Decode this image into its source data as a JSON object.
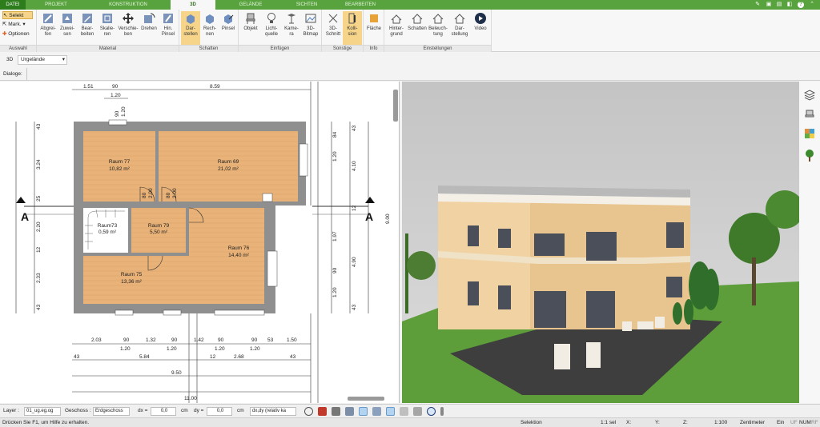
{
  "tabs": [
    "DATEI",
    "PROJEKT",
    "KONSTRUKTION",
    "3D",
    "GELÄNDE",
    "SICHTEN",
    "BEARBEITEN"
  ],
  "window_controls": [
    "?"
  ],
  "ribbon": {
    "auswahl": {
      "label": "Auswahl",
      "selekt": "Selekt",
      "mark": "Mark.",
      "optionen": "Optionen"
    },
    "material": {
      "label": "Material",
      "buttons": [
        "Abgrei-\nfen",
        "Zuwei-\nsen",
        "Bear-\nbeiten",
        "Skalie-\nren",
        "Verschie-\nben",
        "Drehen",
        "Hin.\nPinsel"
      ]
    },
    "schatten": {
      "label": "Schatten",
      "buttons": [
        "Dar-\nstellen",
        "Rech-\nnen",
        "Pinsel"
      ]
    },
    "einfuegen": {
      "label": "Einfügen",
      "buttons": [
        "Objekt",
        "Licht-\nquelle",
        "Kame-\nra",
        "3D-\nBitmap"
      ]
    },
    "sonstige": {
      "label": "Sonstige",
      "buttons": [
        "3D-\nSchnitt",
        "Kolli-\nsion"
      ]
    },
    "info": {
      "label": "Info",
      "buttons": [
        "Fläche"
      ]
    },
    "einstellungen": {
      "label": "Einstellungen",
      "buttons": [
        "Hinter-\ngrund",
        "Schatten",
        "Beleuch-\ntung",
        "Dar-\nstellung",
        "Video"
      ]
    }
  },
  "viewbar": {
    "mode": "3D",
    "terrain": "Urgelände"
  },
  "dialog_label": "Dialoge:",
  "plan": {
    "rooms": [
      {
        "name": "Raum 77",
        "area": "10,82 m²"
      },
      {
        "name": "Raum 69",
        "area": "21,02 m²"
      },
      {
        "name": "Raum73",
        "area": "0,59 m²"
      },
      {
        "name": "Raum 79",
        "area": "5,50 m²"
      },
      {
        "name": "Raum 76",
        "area": "14,40 m²"
      },
      {
        "name": "Raum 75",
        "area": "13,36 m²"
      }
    ],
    "dims_top": [
      "1.51",
      "90",
      "8.59"
    ],
    "dims_top2": "1.20",
    "dims_left": [
      "43",
      "3.24",
      "25",
      "2.20",
      "12",
      "2.33",
      "43"
    ],
    "dims_right": [
      "43",
      "4.10",
      "12",
      "4.90",
      "43"
    ],
    "dims_right_outer": "9.00",
    "dims_bottom1": [
      "2.03",
      "90",
      "1.32",
      "90",
      "1.42",
      "90",
      "90",
      "53",
      "1.50"
    ],
    "dims_bottom1b": [
      "1.20",
      "1.20",
      "1.20",
      "1.20"
    ],
    "dims_bottom2": [
      "43",
      "5.84",
      "12",
      "2.68",
      "43"
    ],
    "dims_bottom3": "9.50",
    "dims_bottom4": "11.00",
    "small_dims": [
      "80",
      "2.00",
      "90",
      "1.20",
      "84",
      "1.20",
      "1.97",
      "90",
      "1.20"
    ],
    "section_marker": "A"
  },
  "bottom": {
    "layer_label": "Layer :",
    "layer_value": "01_ug.eg.og",
    "geschoss_label": "Geschoss :",
    "geschoss_value": "Erdgeschoss",
    "dx_label": "dx =",
    "dx_value": "0,0",
    "dy_label": "dy =",
    "dy_value": "0,0",
    "unit": "cm",
    "mode_value": "dx,dy (relativ ka"
  },
  "status": {
    "help": "Drücken Sie F1, um Hilfe zu erhalten.",
    "selection": "Selektion",
    "sel_count": "1:1 sel",
    "x": "X:",
    "y": "Y:",
    "z": "Z:",
    "scale": "1:100",
    "unit": "Zentimeter",
    "ein": "Ein",
    "uf": "UF",
    "num": "NUM",
    "rf": "RF"
  },
  "colors": {
    "accent": "#58a33d",
    "floor": "#e8b278",
    "wall": "#8f8f8f",
    "active": "#f6d58a"
  }
}
